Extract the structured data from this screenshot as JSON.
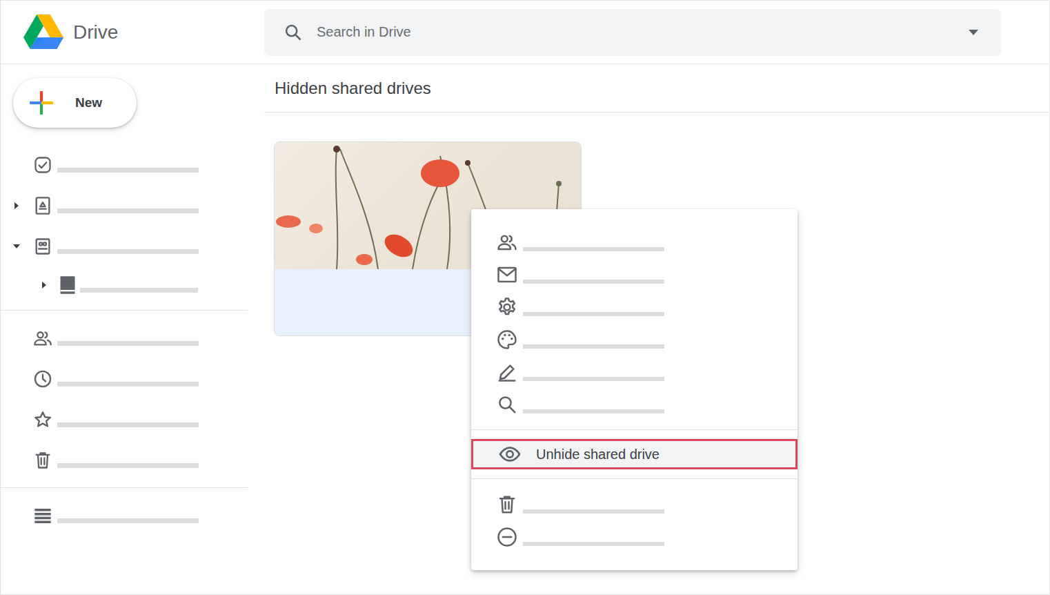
{
  "app": {
    "title": "Drive"
  },
  "search": {
    "placeholder": "Search in Drive"
  },
  "new_button": {
    "label": "New"
  },
  "sidebar": {
    "groups": [
      [
        {
          "kind": "plain"
        },
        {
          "kind": "tree",
          "expanded": false
        },
        {
          "kind": "tree",
          "expanded": true
        },
        {
          "kind": "child",
          "expanded": false
        }
      ],
      [
        {
          "kind": "plain"
        },
        {
          "kind": "plain"
        },
        {
          "kind": "plain"
        },
        {
          "kind": "plain"
        }
      ],
      [
        {
          "kind": "plain"
        }
      ]
    ]
  },
  "page": {
    "heading": "Hidden shared drives"
  },
  "drives": [
    {
      "selected": true
    }
  ],
  "context_menu": {
    "groups": [
      [
        {
          "kind": "placeholder"
        },
        {
          "kind": "placeholder"
        },
        {
          "kind": "placeholder"
        },
        {
          "kind": "placeholder"
        },
        {
          "kind": "placeholder"
        },
        {
          "kind": "placeholder"
        }
      ],
      [
        {
          "kind": "action",
          "label": "Unhide shared drive",
          "selected": true
        }
      ],
      [
        {
          "kind": "placeholder"
        },
        {
          "kind": "placeholder"
        }
      ]
    ]
  }
}
